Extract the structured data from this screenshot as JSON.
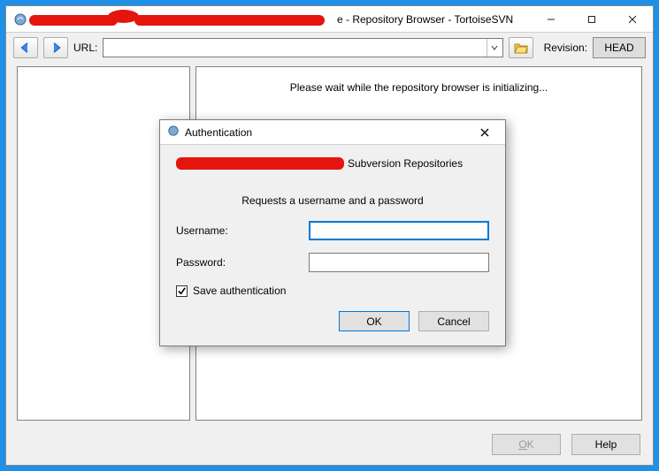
{
  "window": {
    "title_suffix": "e - Repository Browser - TortoiseSVN"
  },
  "toolbar": {
    "url_label": "URL:",
    "url_value": "",
    "revision_label": "Revision:",
    "revision_value": "HEAD"
  },
  "main": {
    "status_text": "Please wait while the repository browser is initializing..."
  },
  "footer": {
    "ok_label": "OK",
    "help_label": "Help"
  },
  "dialog": {
    "title": "Authentication",
    "subversion_label": "Subversion Repositories",
    "request_text": "Requests a username and a password",
    "username_label": "Username:",
    "username_value": "",
    "password_label": "Password:",
    "password_value": "",
    "save_auth_label": "Save authentication",
    "save_auth_checked": true,
    "ok_label": "OK",
    "cancel_label": "Cancel"
  }
}
